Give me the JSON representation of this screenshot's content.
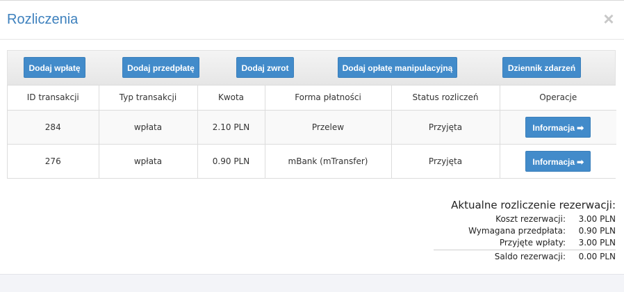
{
  "modal": {
    "title": "Rozliczenia",
    "close_icon": "×"
  },
  "toolbar": {
    "buttons": [
      {
        "label": "Dodaj wpłatę"
      },
      {
        "label": "Dodaj przedpłatę"
      },
      {
        "label": "Dodaj zwrot"
      },
      {
        "label": "Dodaj opłatę manipulacyjną"
      },
      {
        "label": "Dziennik zdarzeń"
      }
    ]
  },
  "table": {
    "headers": [
      "ID transakcji",
      "Typ transakcji",
      "Kwota",
      "Forma płatności",
      "Status rozliczeń",
      "Operacje"
    ],
    "rows": [
      {
        "id": "284",
        "type": "wpłata",
        "amount": "2.10 PLN",
        "method": "Przelew",
        "status": "Przyjęta",
        "action_label": "Informacja",
        "action_icon": "➡"
      },
      {
        "id": "276",
        "type": "wpłata",
        "amount": "0.90 PLN",
        "method": "mBank (mTransfer)",
        "status": "Przyjęta",
        "action_label": "Informacja",
        "action_icon": "➡"
      }
    ]
  },
  "summary": {
    "title": "Aktualne rozliczenie rezerwacji:",
    "items": [
      {
        "label": "Koszt rezerwacji:",
        "value": "3.00 PLN"
      },
      {
        "label": "Wymagana przedpłata:",
        "value": "0.90 PLN"
      },
      {
        "label": "Przyjęte wpłaty:",
        "value": "3.00 PLN"
      },
      {
        "label": "Saldo rezerwacji:",
        "value": "0.00 PLN"
      }
    ]
  },
  "colors": {
    "accent": "#428bca",
    "title": "#3d80bd"
  }
}
